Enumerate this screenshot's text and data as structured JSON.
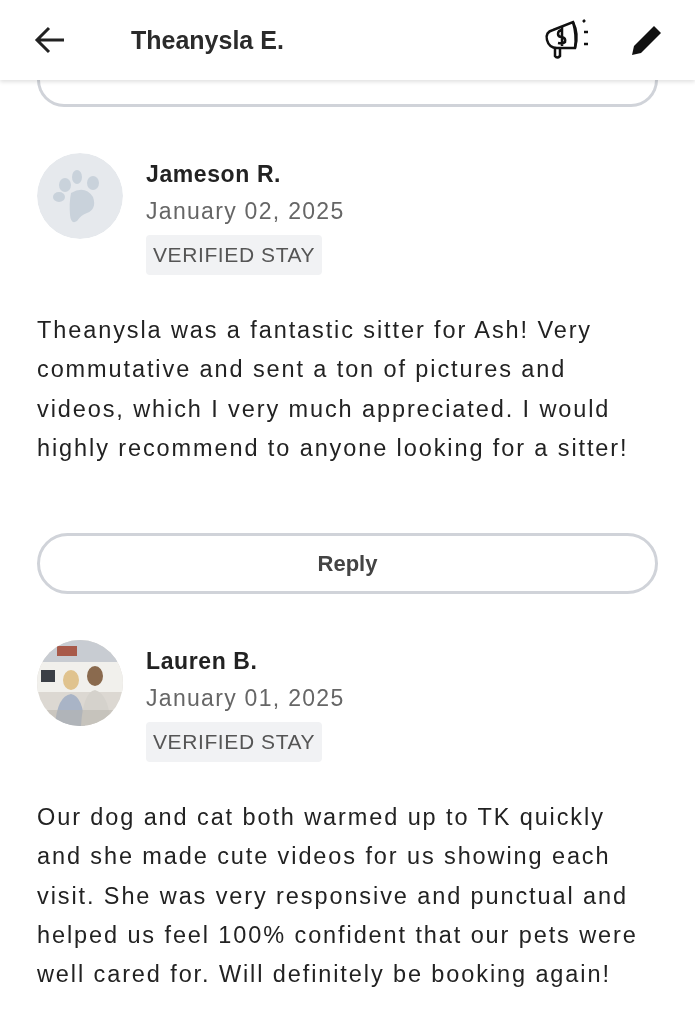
{
  "header": {
    "title": "Theanysla E."
  },
  "reviews": [
    {
      "avatar": {
        "kind": "paw"
      },
      "name": "Jameson R.",
      "date": "January 02, 2025",
      "badge": "VERIFIED STAY",
      "text": "Theanysla was a fantastic sitter for Ash! Very commutative and sent a ton of pictures and videos, which I very much appreciated. I would highly recommend to anyone looking for a sitter!",
      "reply_button": "Reply"
    },
    {
      "name": "Lauren B.",
      "date": "January 01, 2025",
      "badge": "VERIFIED STAY",
      "text": "Our dog and cat both warmed up to TK quickly and she made cute videos for us showing each visit. She was very responsive and punctual and helped us feel 100% confident that our pets were well cared for. Will definitely be booking again!"
    }
  ]
}
